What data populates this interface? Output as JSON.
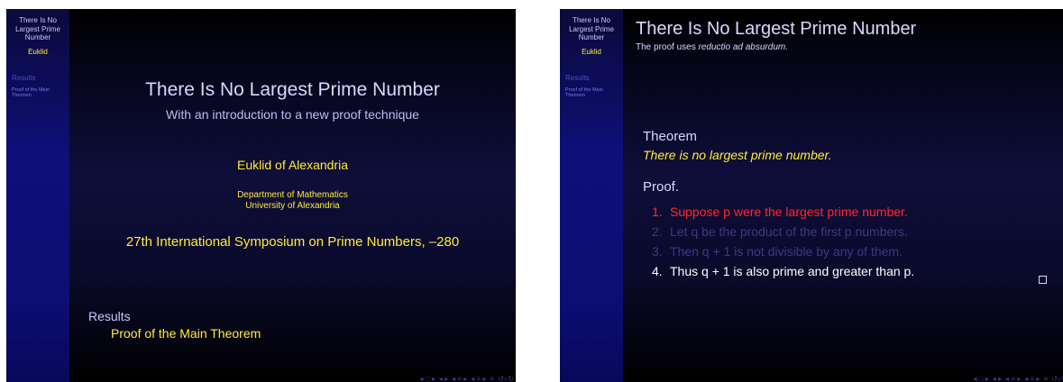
{
  "sidebar": {
    "title": "There Is No Largest Prime Number",
    "author": "Euklid",
    "section": "Results",
    "subsection": "Proof of the Main Theorem"
  },
  "slide1": {
    "title": "There Is No Largest Prime Number",
    "subtitle": "With an introduction to a new proof technique",
    "author": "Euklid of Alexandria",
    "institute_line1": "Department of Mathematics",
    "institute_line2": "University of Alexandria",
    "conference": "27th International Symposium on Prime Numbers, –280",
    "toc_section": "Results",
    "toc_subsection": "Proof of the Main Theorem"
  },
  "slide2": {
    "frame_title": "There Is No Largest Prime Number",
    "frame_subtitle_prefix": "The proof uses ",
    "frame_subtitle_emph": "reductio ad absurdum.",
    "theorem_label": "Theorem",
    "theorem_text": "There is no largest prime number.",
    "proof_label": "Proof.",
    "steps": [
      {
        "num": "1.",
        "text": "Suppose p were the largest prime number."
      },
      {
        "num": "2.",
        "text": "Let q be the product of the first p numbers."
      },
      {
        "num": "3.",
        "text": "Then q + 1 is not divisible by any of them."
      },
      {
        "num": "4.",
        "text": "Thus q + 1 is also prime and greater than p."
      }
    ],
    "qed_symbol": "□"
  },
  "nav": {
    "icons": [
      "nav-slide-icon",
      "nav-frame-icon",
      "nav-subsection-icon",
      "nav-section-icon",
      "nav-align-icon",
      "nav-search-icon"
    ],
    "glyphs": [
      "◂ □ ▸",
      "◂ ▸",
      "◂ ≡ ▸",
      "◂ ≡ ▸",
      "≡",
      "↺⌕↻"
    ]
  },
  "colors": {
    "accent": "#ffeb3b",
    "alert": "#ff2a2a",
    "text": "#d8d8ff",
    "sidebar": "#0f0f7a"
  }
}
